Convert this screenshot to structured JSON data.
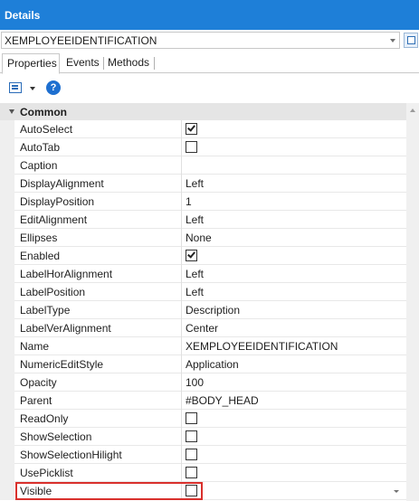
{
  "window": {
    "title": "Details"
  },
  "object_selector": {
    "value": "XEMPLOYEEIDENTIFICATION"
  },
  "tabs": [
    {
      "label": "Properties",
      "active": true
    },
    {
      "label": "Events",
      "active": false
    },
    {
      "label": "Methods",
      "active": false
    }
  ],
  "toolbar": {
    "help_glyph": "?"
  },
  "category": {
    "label": "Common"
  },
  "properties": [
    {
      "name": "AutoSelect",
      "type": "checkbox",
      "checked": true
    },
    {
      "name": "AutoTab",
      "type": "checkbox",
      "checked": false
    },
    {
      "name": "Caption",
      "type": "text",
      "value": ""
    },
    {
      "name": "DisplayAlignment",
      "type": "text",
      "value": "Left"
    },
    {
      "name": "DisplayPosition",
      "type": "text",
      "value": "1"
    },
    {
      "name": "EditAlignment",
      "type": "text",
      "value": "Left"
    },
    {
      "name": "Ellipses",
      "type": "text",
      "value": "None"
    },
    {
      "name": "Enabled",
      "type": "checkbox",
      "checked": true
    },
    {
      "name": "LabelHorAlignment",
      "type": "text",
      "value": "Left"
    },
    {
      "name": "LabelPosition",
      "type": "text",
      "value": "Left"
    },
    {
      "name": "LabelType",
      "type": "text",
      "value": "Description"
    },
    {
      "name": "LabelVerAlignment",
      "type": "text",
      "value": "Center"
    },
    {
      "name": "Name",
      "type": "text",
      "value": "XEMPLOYEEIDENTIFICATION"
    },
    {
      "name": "NumericEditStyle",
      "type": "text",
      "value": "Application"
    },
    {
      "name": "Opacity",
      "type": "text",
      "value": "100"
    },
    {
      "name": "Parent",
      "type": "text",
      "value": "#BODY_HEAD"
    },
    {
      "name": "ReadOnly",
      "type": "checkbox",
      "checked": false
    },
    {
      "name": "ShowSelection",
      "type": "checkbox",
      "checked": false
    },
    {
      "name": "ShowSelectionHilight",
      "type": "checkbox",
      "checked": false
    },
    {
      "name": "UsePicklist",
      "type": "checkbox",
      "checked": false
    },
    {
      "name": "Visible",
      "type": "checkbox",
      "checked": false,
      "selected": true
    }
  ],
  "colors": {
    "titlebar": "#1e7fd8",
    "highlight_border": "#d9302c",
    "category_bg": "#e5e5e5"
  },
  "icons": [
    "categorized-view-icon",
    "dropdown-arrow-icon",
    "help-icon",
    "checkbox-icon",
    "expand-collapse-icon"
  ]
}
